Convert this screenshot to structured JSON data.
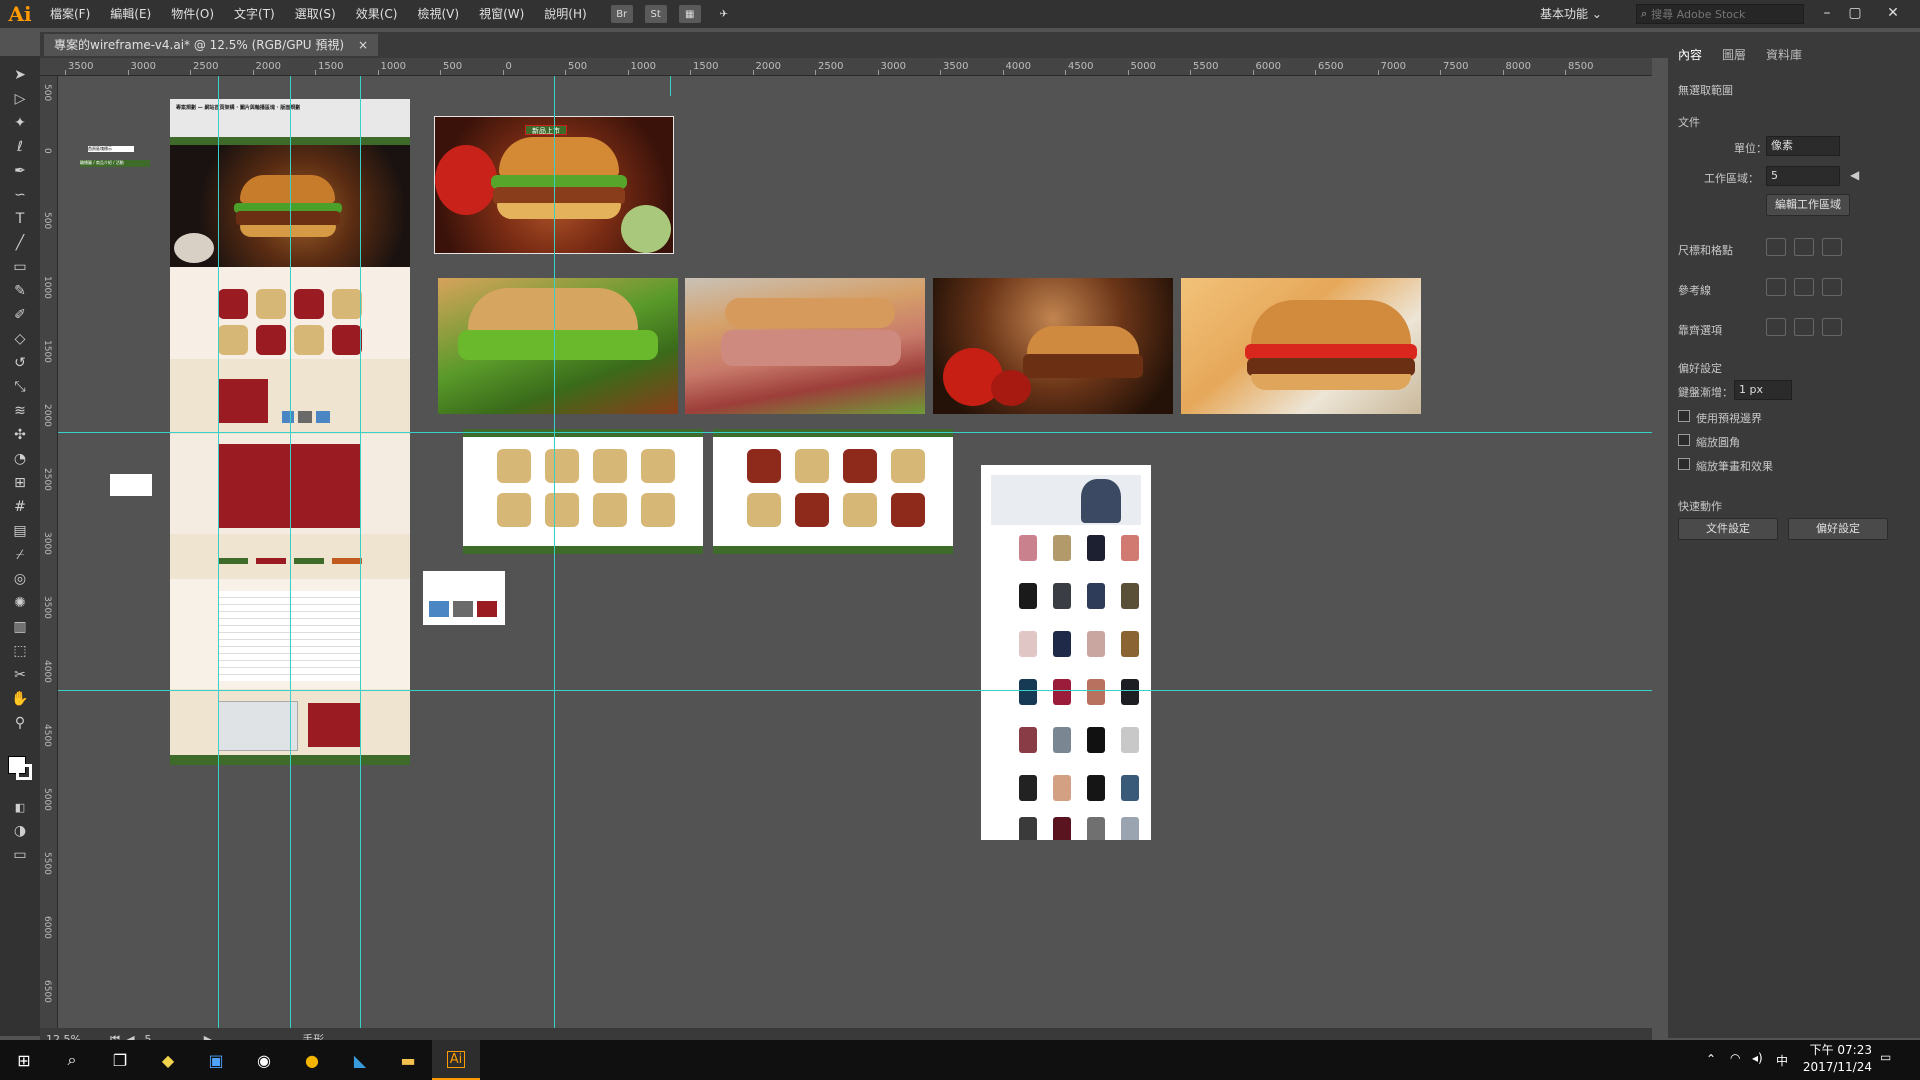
{
  "app": {
    "logo": "Ai"
  },
  "menu": [
    "檔案(F)",
    "編輯(E)",
    "物件(O)",
    "文字(T)",
    "選取(S)",
    "效果(C)",
    "檢視(V)",
    "視窗(W)",
    "說明(H)"
  ],
  "toolbar_icons": {
    "br": "Br",
    "st": "St"
  },
  "workspace": "基本功能",
  "search": {
    "placeholder": "搜尋 Adobe Stock"
  },
  "document_tab": {
    "title": "專案的wireframe-v4.ai* @ 12.5% (RGB/GPU 預視)",
    "close": "×"
  },
  "ruler_top": [
    "3500",
    "3000",
    "2500",
    "2000",
    "1500",
    "1000",
    "500",
    "0",
    "500",
    "1000",
    "1500",
    "2000",
    "2500",
    "3000",
    "3500",
    "4000",
    "4500",
    "5000",
    "5500",
    "6000",
    "6500",
    "7000",
    "7500",
    "8000",
    "8500"
  ],
  "ruler_left": [
    "500",
    "0",
    "500",
    "1000",
    "1500",
    "2000",
    "2500",
    "3000",
    "3500",
    "4000",
    "4500",
    "5000",
    "5500",
    "6000",
    "6500"
  ],
  "status": {
    "zoom": "12.5%",
    "artboard": "5",
    "tool": "手形"
  },
  "panel": {
    "tabs": [
      "內容",
      "圖層",
      "資料庫"
    ],
    "no_selection": "無選取範圍",
    "document_label": "文件",
    "units_label": "單位：",
    "units_value": "像素",
    "artboard_label": "工作區域：",
    "artboard_value": "5",
    "edit_artboards": "編輯工作區域",
    "ruler_grid": "尺標和格點",
    "guides": "參考線",
    "snap": "靠齊選項",
    "preferences": "偏好設定",
    "key_increment_label": "鍵盤漸增：",
    "key_increment_value": "1 px",
    "checks": [
      "使用預視邊界",
      "縮放圓角",
      "縮放筆畫和效果"
    ],
    "quick_actions": "快速動作",
    "doc_setup": "文件設定",
    "prefs_btn": "偏好設定"
  },
  "wireframe": {
    "header_text": "專案規劃 — 網站首頁架構 · 圖片與輪播區塊 · 版面規劃",
    "banner_badge": "新品上市",
    "side_note_1": "首頁區塊標示",
    "side_note_2": "輪播圖 / 商品介紹 / 活動"
  },
  "clock": {
    "time": "下午 07:23",
    "date": "2017/11/24"
  },
  "ime": "中",
  "colors": {
    "guide": "#39d0c9",
    "accent_red": "#9a1b22",
    "accent_green": "#3e6b2a",
    "ai_orange": "#ff9a00"
  }
}
